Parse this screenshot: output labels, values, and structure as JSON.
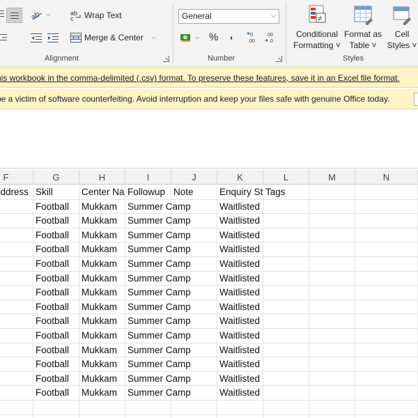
{
  "ribbon": {
    "alignment": {
      "wrap_text_label": "Wrap Text",
      "merge_center_label": "Merge & Center",
      "group_label": "Alignment"
    },
    "number": {
      "format_value": "General",
      "percent_symbol": "%",
      "comma_symbol": ",",
      "group_label": "Number"
    },
    "styles": {
      "conditional_formatting_line1": "Conditional",
      "conditional_formatting_line2": "Formatting ˅",
      "format_as_table_line1": "Format as",
      "format_as_table_line2": "Table ˅",
      "cell_styles_line1": "Cell",
      "cell_styles_line2": "Styles ˅",
      "group_label": "Styles"
    }
  },
  "messages": {
    "csv_warning": "his workbook in the comma-delimited (.csv) format. To preserve these features, save it in an Excel file format.",
    "counterfeit_warning": "be a victim of software counterfeiting. Avoid interruption and keep your files safe with genuine Office today."
  },
  "grid": {
    "column_letters": [
      "F",
      "G",
      "H",
      "I",
      "J",
      "K",
      "L",
      "M",
      "N"
    ],
    "headers": [
      "ddress",
      "Skill",
      "Center Na",
      "Followup",
      "Note",
      "Enquiry St",
      "Tags",
      "",
      ""
    ],
    "rows": [
      [
        "",
        "Football",
        "Mukkam",
        "Summer Camp",
        "",
        "Waitlisted",
        "",
        "",
        ""
      ],
      [
        "",
        "Football",
        "Mukkam",
        "Summer Camp",
        "",
        "Waitlisted",
        "",
        "",
        ""
      ],
      [
        "",
        "Football",
        "Mukkam",
        "Summer Camp",
        "",
        "Waitlisted",
        "",
        "",
        ""
      ],
      [
        "",
        "Football",
        "Mukkam",
        "Summer Camp",
        "",
        "Waitlisted",
        "",
        "",
        ""
      ],
      [
        "",
        "Football",
        "Mukkam",
        "Summer Camp",
        "",
        "Waitlisted",
        "",
        "",
        ""
      ],
      [
        "",
        "Football",
        "Mukkam",
        "Summer Camp",
        "",
        "Waitlisted",
        "",
        "",
        ""
      ],
      [
        "",
        "Football",
        "Mukkam",
        "Summer Camp",
        "",
        "Waitlisted",
        "",
        "",
        ""
      ],
      [
        "",
        "Football",
        "Mukkam",
        "Summer Camp",
        "",
        "Waitlisted",
        "",
        "",
        ""
      ],
      [
        "",
        "Football",
        "Mukkam",
        "Summer Camp",
        "",
        "Waitlisted",
        "",
        "",
        ""
      ],
      [
        "",
        "Football",
        "Mukkam",
        "Summer Camp",
        "",
        "Waitlisted",
        "",
        "",
        ""
      ],
      [
        "",
        "Football",
        "Mukkam",
        "Summer Camp",
        "",
        "Waitlisted",
        "",
        "",
        ""
      ],
      [
        "",
        "Football",
        "Mukkam",
        "Summer Camp",
        "",
        "Waitlisted",
        "",
        "",
        ""
      ],
      [
        "",
        "Football",
        "Mukkam",
        "Summer Camp",
        "",
        "Waitlisted",
        "",
        "",
        ""
      ],
      [
        "",
        "Football",
        "Mukkam",
        "Summer Camp",
        "",
        "Waitlisted",
        "",
        "",
        ""
      ],
      [
        "",
        "",
        "",
        "",
        "",
        "",
        "",
        "",
        ""
      ],
      [
        "",
        "",
        "",
        "",
        "",
        "",
        "",
        "",
        ""
      ]
    ]
  },
  "colors": {
    "message_bar_bg": "#fdf3c4",
    "ribbon_bg": "#f3f3f3",
    "accent_blue": "#2e6db4",
    "accent_red": "#d9342b"
  }
}
